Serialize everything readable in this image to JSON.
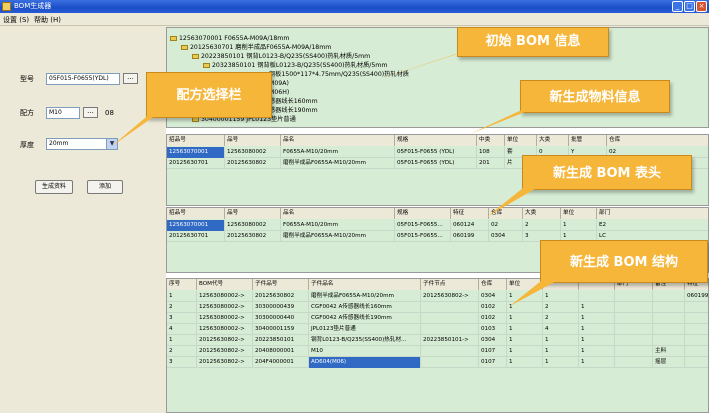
{
  "window": {
    "title": "BOM生成器"
  },
  "menu": {
    "items": [
      {
        "label": "设置 (S)"
      },
      {
        "label": "帮助 (H)"
      }
    ]
  },
  "left": {
    "model_label": "型号",
    "model_value": "05F015-F0655(YDL)",
    "recipe_label": "配方",
    "recipe_value": "M10",
    "recipe_code": "08",
    "thickness_label": "厚度",
    "thickness_value": "20mm",
    "browse_label": "...",
    "generate_label": "生成资料",
    "add_label": "添加"
  },
  "tree": {
    "lines": [
      "12563070001 F0655A-M09A/18mm",
      "20125630701 磨削半成品F0655A-M09A/18mm",
      "20223850101 钢背L0123-B/Q235(SS400)热轧材质/5mm",
      "20323850101 钢背板L0123-B/Q235(SS400)热轧材质/5mm",
      "钢板1500*117*4.75mm/Q235(SS400)热轧材质",
      "M09A)",
      "M06H)",
      "感器线长160mm",
      "感器线长190mm",
      "30400001159 JPL0123垫片普通"
    ]
  },
  "grid1": {
    "columns": [
      "招品号",
      "品号",
      "品名",
      "规格",
      "中类",
      "单位",
      "大类",
      "批管",
      "仓库"
    ],
    "rows": [
      [
        "12563070001",
        "12563080002",
        "F0655A-M10/20mm",
        "05F015-F0655 (YDL)",
        "108",
        "套",
        "0",
        "Y",
        "02"
      ],
      [
        "20125630701",
        "20125630802",
        "磨削半成品F0655A-M10/20mm",
        "05F015-F0655 (YDL)",
        "201",
        "片",
        "",
        "",
        ""
      ]
    ]
  },
  "grid2": {
    "columns": [
      "招品号",
      "品号",
      "品名",
      "规格",
      "特征",
      "仓库",
      "大类",
      "单位",
      "部门"
    ],
    "rows": [
      [
        "12563070001",
        "12563080002",
        "F0655A-M10/20mm",
        "05F015-F0655...",
        "060124",
        "02",
        "2",
        "1",
        "E2"
      ],
      [
        "20125630701",
        "20125630802",
        "磨削半成品F0655A-M10/20mm",
        "05F015-F0655...",
        "060199",
        "0304",
        "3",
        "1",
        "LC"
      ]
    ]
  },
  "grid3": {
    "columns": [
      "序号",
      "BOM代号",
      "子件品号",
      "子件品名",
      "子件节点",
      "仓库",
      "单位",
      "",
      "",
      "部门",
      "备注",
      "特征"
    ],
    "rows": [
      [
        "1",
        "12563080002->",
        "20125630802",
        "磨削半成品F0655A-M10/20mm",
        "20125630802->",
        "0304",
        "1",
        "1",
        "",
        "",
        "",
        "060199"
      ],
      [
        "2",
        "12563080002->",
        "30300000439",
        "CGF0042 A传感器线长160mm",
        "",
        "0102",
        "1",
        "2",
        "1",
        "",
        "",
        ""
      ],
      [
        "3",
        "12563080002->",
        "30300000440",
        "CGF0042 A传感器线长190mm",
        "",
        "0102",
        "1",
        "2",
        "1",
        "",
        "",
        ""
      ],
      [
        "4",
        "12563080002->",
        "30400001159",
        "JPL0123垫片普通",
        "",
        "0103",
        "1",
        "4",
        "1",
        "",
        "",
        ""
      ],
      [
        "1",
        "20125630802->",
        "20223850101",
        "钢背L0123-B/Q235(SS400)热轧材...",
        "20223850101->",
        "0304",
        "1",
        "1",
        "1",
        "",
        "",
        ""
      ],
      [
        "2",
        "20125630802->",
        "20408000001",
        "M10",
        "",
        "0107",
        "1",
        "1",
        "1",
        "",
        "主料",
        ""
      ],
      [
        "3",
        "20125630802->",
        "204F4000001",
        "AD604(M06)",
        "",
        "0107",
        "1",
        "1",
        "1",
        "",
        "摇层",
        ""
      ]
    ]
  },
  "callouts": {
    "initial_bom": "初始 BOM 信息",
    "recipe_bar": "配方选择栏",
    "new_material": "新生成物料信息",
    "new_bom_header": "新生成 BOM 表头",
    "new_bom_structure": "新生成 BOM 结构"
  },
  "colors": {
    "accent": "#f6b63a",
    "selection": "#316ac5",
    "panel_green": "#d6ecd4"
  }
}
